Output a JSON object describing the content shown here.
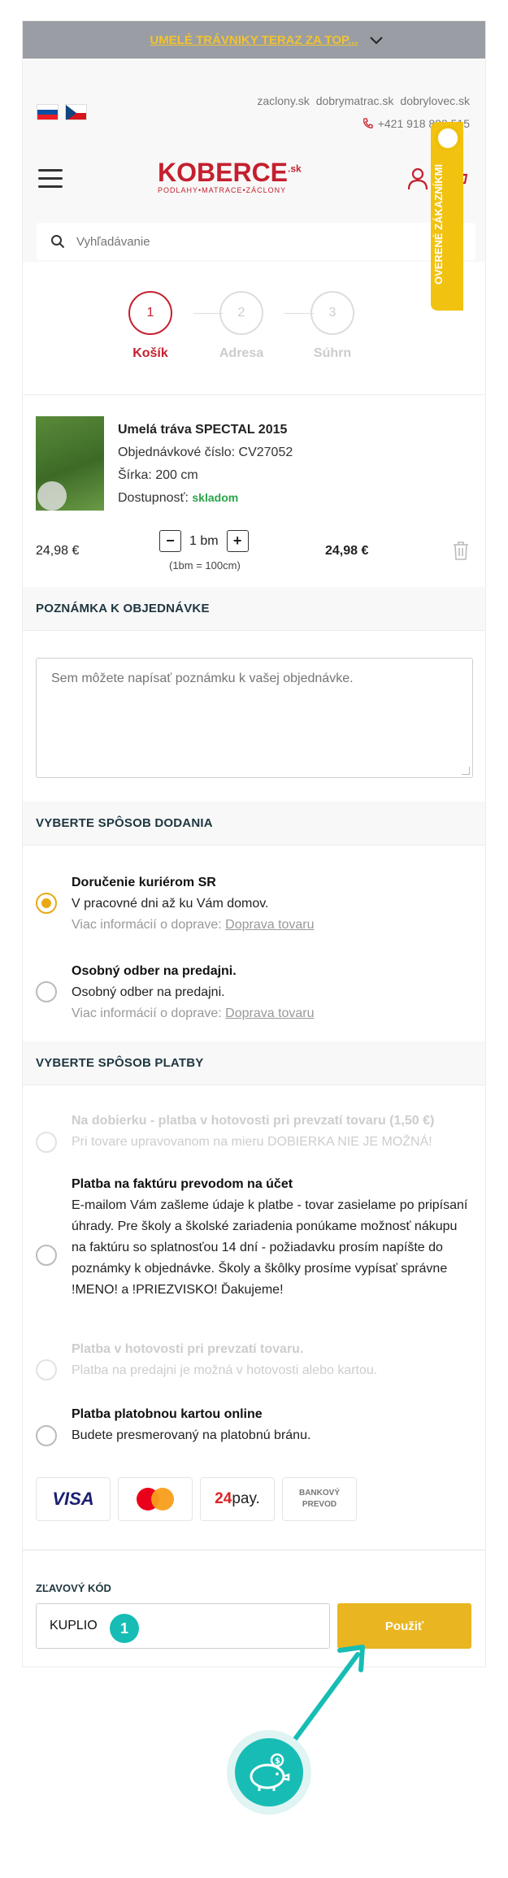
{
  "promo": {
    "text": "UMELÉ TRÁVNIKY TERAZ ZA TOP..."
  },
  "top_links": [
    "zaclony.sk",
    "dobrymatrac.sk",
    "dobrylovec.sk"
  ],
  "phone": "+421 918 888 515",
  "logo": {
    "main": "KOBERCE",
    "suffix": ".sk",
    "tagline": "PODLAHY•MATRACE•ZÁCLONY"
  },
  "search": {
    "placeholder": "Vyhľadávanie"
  },
  "verified_badge": "OVERENÉ ZÁKAZNÍKMI",
  "steps": [
    {
      "number": "1",
      "label": "Košík",
      "active": true
    },
    {
      "number": "2",
      "label": "Adresa",
      "active": false
    },
    {
      "number": "3",
      "label": "Súhrn",
      "active": false
    }
  ],
  "product": {
    "title": "Umelá tráva SPECTAL 2015",
    "order_number": "Objednávkové číslo: CV27052",
    "width": "Šírka: 200 cm",
    "availability_label": "Dostupnosť:",
    "availability_value": "skladom",
    "unit_price": "24,98  €",
    "quantity": "1 bm",
    "quantity_note": "(1bm = 100cm)",
    "total_price": "24,98  €",
    "minus": "−",
    "plus": "+"
  },
  "order_note": {
    "heading": "POZNÁMKA K OBJEDNÁVKE",
    "placeholder": "Sem môžete napísať poznámku k vašej objednávke."
  },
  "delivery": {
    "heading": "VYBERTE SPÔSOB DODANIA",
    "options": [
      {
        "title": "Doručenie kuriérom SR",
        "desc": "V pracovné dni až ku Vám domov.",
        "more_label": "Viac informácií o doprave:",
        "more_link": "Doprava tovaru",
        "selected": true
      },
      {
        "title": "Osobný odber na predajni.",
        "desc": "Osobný odber na predajni.",
        "more_label": "Viac informácií o doprave:",
        "more_link": "Doprava tovaru",
        "selected": false
      }
    ]
  },
  "payment": {
    "heading": "VYBERTE SPÔSOB PLATBY",
    "options": [
      {
        "title": "Na dobierku - platba v hotovosti pri prevzatí tovaru (1,50 €)",
        "desc": "Pri tovare upravovanom na mieru DOBIERKA NIE JE MOŽNÁ!",
        "disabled": true
      },
      {
        "title": "Platba na faktúru prevodom na účet",
        "desc": "E-mailom Vám zašleme údaje k platbe - tovar zasielame po pripísaní úhrady. Pre školy a školské zariadenia ponúkame možnosť nákupu na faktúru so splatnosťou 14 dní - požiadavku prosím napíšte do poznámky k objednávke. Školy a škôlky prosíme vypísať správne !MENO! a !PRIEZVISKO! Ďakujeme!",
        "disabled": false
      },
      {
        "title": "Platba v hotovosti pri prevzatí tovaru.",
        "desc": "Platba na predajni je možná v hotovosti alebo kartou.",
        "disabled": true
      },
      {
        "title": "Platba platobnou kartou online",
        "desc": "Budete presmerovaný na platobnú bránu.",
        "disabled": false
      }
    ],
    "logos": {
      "visa": "VISA",
      "p24_a": "24",
      "p24_b": "pay.",
      "bank_line1": "BANKOVÝ",
      "bank_line2": "PREVOD"
    }
  },
  "discount": {
    "label": "ZĽAVOVÝ KÓD",
    "value": "KUPLIO",
    "button": "Použiť",
    "marker": "1"
  },
  "colors": {
    "accent": "#e9b521",
    "brand_red": "#c4202f",
    "teal": "#17bdb5"
  }
}
